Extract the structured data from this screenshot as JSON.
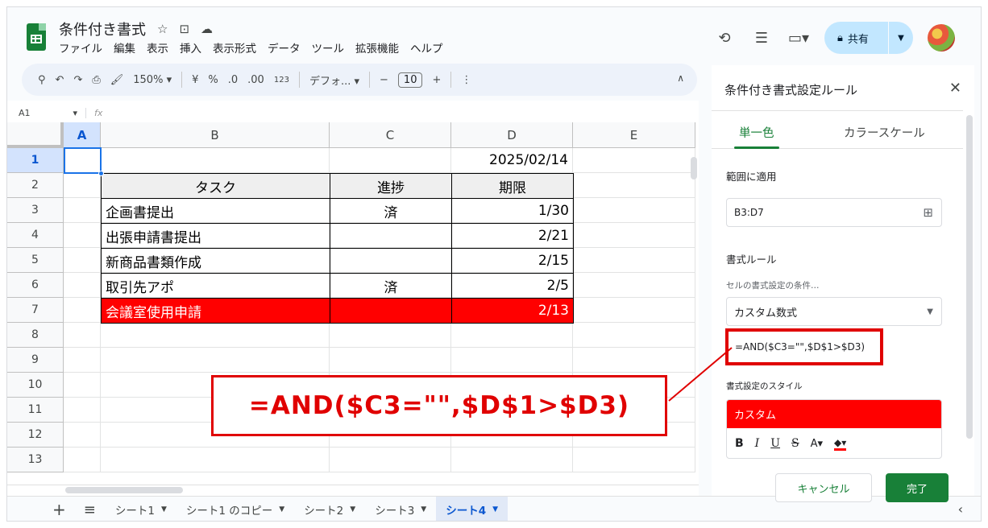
{
  "header": {
    "title": "条件付き書式",
    "menu": [
      "ファイル",
      "編集",
      "表示",
      "挿入",
      "表示形式",
      "データ",
      "ツール",
      "拡張機能",
      "ヘルプ"
    ],
    "share_label": "共有"
  },
  "toolbar": {
    "zoom": "150%",
    "currency": "¥",
    "percent": "%",
    "dec_decrease": ".0",
    "dec_increase": ".00",
    "number_format": "123",
    "font": "デフォ...",
    "font_size": "10"
  },
  "formula_bar": {
    "cell_ref": "A1",
    "fx": "fx"
  },
  "grid": {
    "columns": [
      "A",
      "B",
      "C",
      "D",
      "E"
    ],
    "rows": [
      "1",
      "2",
      "3",
      "4",
      "5",
      "6",
      "7",
      "8",
      "9",
      "10",
      "11",
      "12",
      "13"
    ],
    "date": "2025/02/14",
    "table_header": [
      "タスク",
      "進捗",
      "期限"
    ],
    "table_rows": [
      [
        "企画書提出",
        "済",
        "1/30"
      ],
      [
        "出張申請書提出",
        "",
        "2/21"
      ],
      [
        "新商品書類作成",
        "",
        "2/15"
      ],
      [
        "取引先アポ",
        "済",
        "2/5"
      ],
      [
        "会議室使用申請",
        "",
        "2/13"
      ]
    ],
    "highlight_color": "#ff0000"
  },
  "callout": {
    "text": "=AND($C3=\"\",$D$1>$D3)",
    "color": "#e00000"
  },
  "sheets": {
    "tabs": [
      "シート1",
      "シート1 のコピー",
      "シート2",
      "シート3",
      "シート4"
    ],
    "active": "シート4"
  },
  "panel": {
    "title": "条件付き書式設定ルール",
    "tab_single": "単一色",
    "tab_scale": "カラースケール",
    "range_label": "範囲に適用",
    "range_value": "B3:D7",
    "rules_label": "書式ルール",
    "condition_label": "セルの書式設定の条件…",
    "condition_value": "カスタム数式",
    "formula": "=AND($C3=\"\",$D$1>$D3)",
    "style_label": "書式設定のスタイル",
    "style_preview": "カスタム",
    "cancel": "キャンセル",
    "done": "完了",
    "accent": "#188038"
  }
}
